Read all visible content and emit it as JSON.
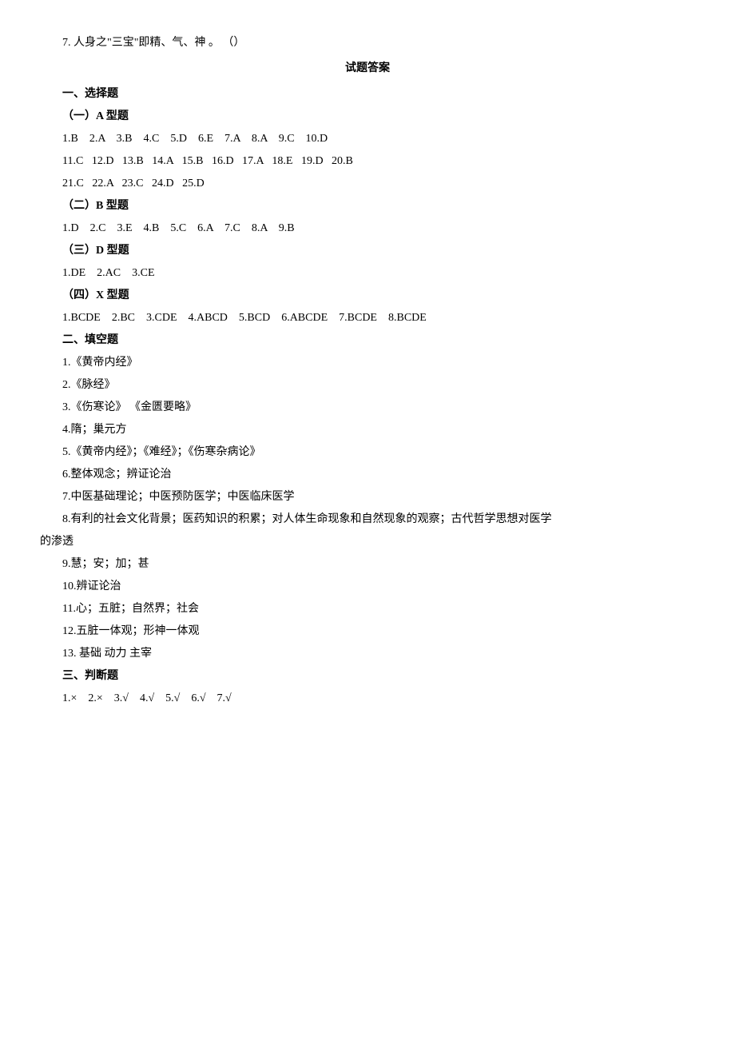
{
  "q7": "7. 人身之\"三宝\"即精、气、神 。    （）",
  "answerTitle": "试题答案",
  "section1": "一、选择题",
  "subA": "（一）A 型题",
  "aLine1": "1.B    2.A    3.B    4.C    5.D    6.E    7.A    8.A    9.C    10.D",
  "aLine2": "11.C   12.D   13.B   14.A   15.B   16.D   17.A   18.E   19.D   20.B",
  "aLine3": "21.C   22.A   23.C   24.D   25.D",
  "subB": "（二）B 型题",
  "bLine1": "1.D    2.C    3.E    4.B    5.C    6.A    7.C    8.A    9.B",
  "subD": "（三）D 型题",
  "dLine1": "1.DE    2.AC    3.CE",
  "subX": "（四）X 型题",
  "xLine1": "1.BCDE    2.BC    3.CDE    4.ABCD    5.BCD    6.ABCDE    7.BCDE    8.BCDE",
  "section2": "二、填空题",
  "fill1": "1.《黄帝内经》",
  "fill2": "2.《脉经》",
  "fill3": "3.《伤寒论》 《金匮要略》",
  "fill4": "4.隋；巢元方",
  "fill5": "5.《黄帝内经》；《难经》；《伤寒杂病论》",
  "fill6": "6.整体观念；辨证论治",
  "fill7": "7.中医基础理论；中医预防医学；中医临床医学",
  "fill8": "8.有利的社会文化背景；医药知识的积累；对人体生命现象和自然现象的观察；古代哲学思想对医学",
  "fill8b": "的渗透",
  "fill9": "9.慧；安；加；甚",
  "fill10": "10.辨证论治",
  "fill11": "11.心；五脏；自然界；社会",
  "fill12": "12.五脏一体观；形神一体观",
  "fill13": "13. 基础   动力  主宰",
  "section3": "三、判断题",
  "judge1": "1.×    2.×    3.√    4.√    5.√    6.√    7.√"
}
